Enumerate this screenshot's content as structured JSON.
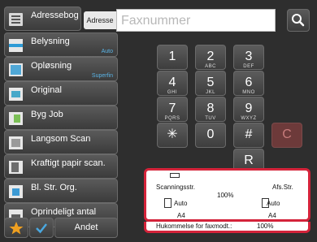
{
  "address_book_label": "Adressebog",
  "address_label": "Adresse",
  "fax_placeholder": "Faxnummer",
  "functions": [
    {
      "label": "Belysning",
      "sub": "Auto"
    },
    {
      "label": "Opløsning",
      "sub": "Superfin"
    },
    {
      "label": "Original",
      "sub": ""
    },
    {
      "label": "Byg Job",
      "sub": ""
    },
    {
      "label": "Langsom Scan",
      "sub": ""
    },
    {
      "label": "Kraftigt papir scan.",
      "sub": ""
    },
    {
      "label": "Bl. Str. Org.",
      "sub": ""
    },
    {
      "label": "Oprindeligt antal",
      "sub": ""
    }
  ],
  "other_label": "Andet",
  "keypad": [
    {
      "digit": "1",
      "letters": ""
    },
    {
      "digit": "2",
      "letters": "ABC"
    },
    {
      "digit": "3",
      "letters": "DEF"
    },
    {
      "digit": "4",
      "letters": "GHI"
    },
    {
      "digit": "5",
      "letters": "JKL"
    },
    {
      "digit": "6",
      "letters": "MNO"
    },
    {
      "digit": "7",
      "letters": "PQRS"
    },
    {
      "digit": "8",
      "letters": "TUV"
    },
    {
      "digit": "9",
      "letters": "WXYZ"
    },
    {
      "digit": "✳",
      "letters": ""
    },
    {
      "digit": "0",
      "letters": ""
    },
    {
      "digit": "#",
      "letters": ""
    },
    {
      "digit": "C",
      "letters": ""
    },
    {
      "digit": "R",
      "letters": ""
    }
  ],
  "info": {
    "scan_size_label": "Scanningsstr.",
    "ratio": "100%",
    "send_size_label": "Afs.Str.",
    "scan_mode": "Auto",
    "scan_paper": "A4",
    "send_mode": "Auto",
    "send_paper": "A4",
    "memory_label": "Hukommelse for faxmodt.:",
    "memory_value": "100%"
  },
  "colors": {
    "highlight_border": "#d4233a",
    "accent_blue": "#5ab4e6",
    "star": "#f0a020",
    "check": "#4aa8e0"
  }
}
